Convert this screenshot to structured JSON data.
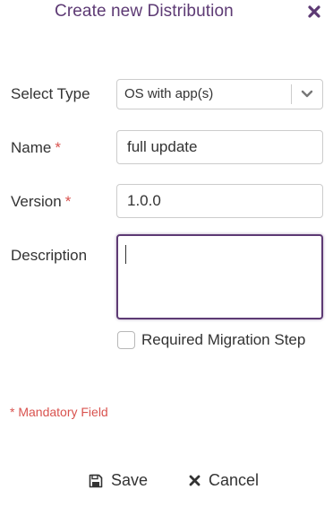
{
  "dialog": {
    "title": "Create new Distribution",
    "close_icon": "close-icon"
  },
  "form": {
    "select_type": {
      "label": "Select Type",
      "value": "OS with app(s)"
    },
    "name": {
      "label": "Name",
      "required_marker": "*",
      "value": "full update"
    },
    "version": {
      "label": "Version",
      "required_marker": "*",
      "value": "1.0.0"
    },
    "description": {
      "label": "Description",
      "value": ""
    },
    "required_migration": {
      "label": "Required Migration Step",
      "checked": false
    }
  },
  "mandatory_note": "* Mandatory Field",
  "footer": {
    "save_label": "Save",
    "cancel_label": "Cancel"
  },
  "colors": {
    "accent": "#5d3a74",
    "required": "#d9534f",
    "border": "#cccccc",
    "text": "#333333"
  }
}
